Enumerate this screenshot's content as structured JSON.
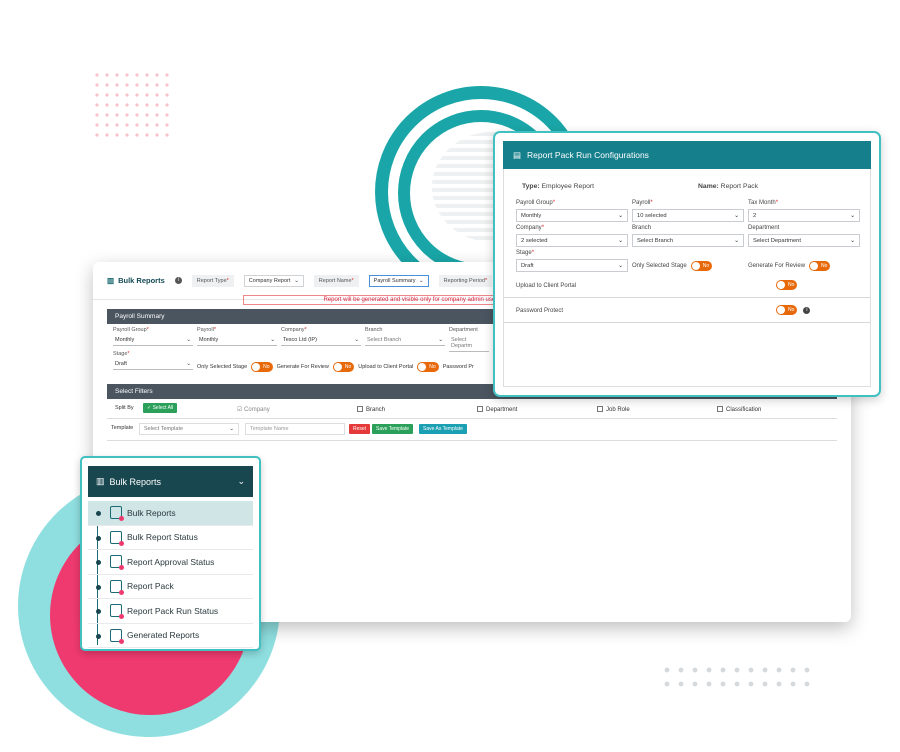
{
  "main": {
    "title": "Bulk Reports",
    "report_type_label": "Report Type",
    "report_type_value": "Company Report",
    "report_name_label": "Report Name",
    "report_name_value": "Payroll Summary",
    "reporting_period_label": "Reporting Period",
    "warning": "Report will be generated and visible only for company admin users, So non",
    "payroll_summary_header": "Payroll Summary",
    "fields": {
      "payroll_group": {
        "label": "Payroll Group",
        "value": "Monthly"
      },
      "payroll": {
        "label": "Payroll",
        "value": "Monthly"
      },
      "company": {
        "label": "Company",
        "value": "Tesco Ltd (IP)"
      },
      "branch": {
        "label": "Branch",
        "placeholder": "Select Branch"
      },
      "department": {
        "label": "Department",
        "placeholder": "Select Departm"
      },
      "stage": {
        "label": "Stage",
        "value": "Draft"
      }
    },
    "toggles": {
      "only_selected_stage": "Only Selected Stage",
      "generate_for_review": "Generate For Review",
      "upload_client_portal": "Upload to Client Portal",
      "password_protect": "Password Pr",
      "no": "No"
    },
    "filters_header": "Select Filters",
    "split_by": "Split By",
    "select_all": "Select All",
    "checkboxes": [
      "Company",
      "Branch",
      "Department",
      "Job Role",
      "Classification"
    ],
    "template_label": "Template",
    "template_placeholder": "Select Template",
    "template_name_placeholder": "Template Name",
    "reset": "Reset",
    "save_template": "Save Template",
    "save_as_template": "Save As Template"
  },
  "popup": {
    "title": "Report Pack Run Configurations",
    "type_label": "Type:",
    "type_value": "Employee Report",
    "name_label": "Name:",
    "name_value": "Report Pack",
    "payroll_group": {
      "label": "Payroll Group",
      "value": "Monthly"
    },
    "payroll": {
      "label": "Payroll",
      "value": "10 selected"
    },
    "tax_month": {
      "label": "Tax Month",
      "value": "2"
    },
    "company": {
      "label": "Company",
      "value": "2 selected"
    },
    "branch": {
      "label": "Branch",
      "placeholder": "Select Branch"
    },
    "department": {
      "label": "Department",
      "placeholder": "Select Department"
    },
    "stage": {
      "label": "Stage",
      "value": "Draft"
    },
    "only_selected_stage": "Only Selected Stage",
    "generate_for_review": "Generate For Review",
    "upload_client_portal": "Upload to Client Portal",
    "password_protect": "Password Protect",
    "no": "No"
  },
  "sidebar": {
    "title": "Bulk Reports",
    "items": [
      {
        "label": "Bulk Reports"
      },
      {
        "label": "Bulk Report Status"
      },
      {
        "label": "Report Approval Status"
      },
      {
        "label": "Report Pack"
      },
      {
        "label": "Report Pack Run Status"
      },
      {
        "label": "Generated Reports"
      }
    ]
  },
  "colors": {
    "teal": "#1aa6a8",
    "pink": "#ef3a6f",
    "orange": "#e8690a",
    "dark_teal": "#184750"
  }
}
